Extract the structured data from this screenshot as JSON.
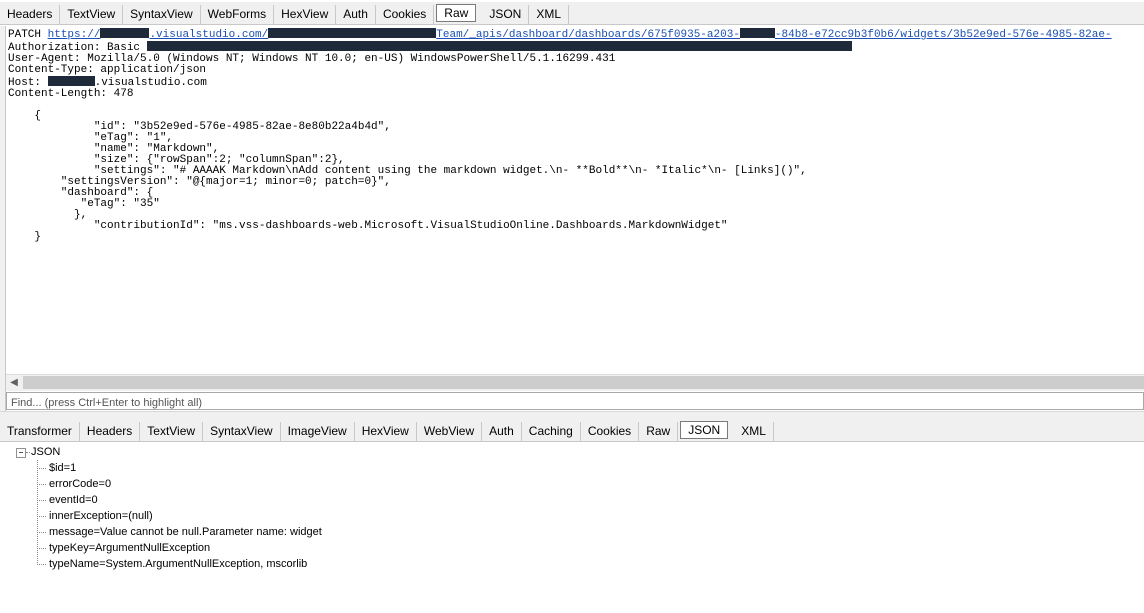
{
  "request_tabs": [
    "Headers",
    "TextView",
    "SyntaxView",
    "WebForms",
    "HexView",
    "Auth",
    "Cookies",
    "Raw",
    "JSON",
    "XML"
  ],
  "request_active_tab": "Raw",
  "raw": {
    "method": "PATCH",
    "url_start": "https://",
    "url_host": ".visualstudio.com/",
    "url_path": "Team/_apis/dashboard/dashboards/675f0935-a203-",
    "url_end": "-84b8-e72cc9b3f0b6/widgets/3b52e9ed-576e-4985-82ae-",
    "auth_line": "Authorization: Basic ",
    "user_agent_line": "User-Agent: Mozilla/5.0 (Windows NT; Windows NT 10.0; en-US) WindowsPowerShell/5.1.16299.431",
    "content_type_line": "Content-Type: application/json",
    "host_label": "Host: ",
    "host_value": ".visualstudio.com",
    "content_length_line": "Content-Length: 478",
    "body": "    {\n             \"id\": \"3b52e9ed-576e-4985-82ae-8e80b22a4b4d\",\n             \"eTag\": \"1\",\n             \"name\": \"Markdown\",\n             \"size\": {\"rowSpan\":2; \"columnSpan\":2},\n             \"settings\": \"# AAAAK Markdown\\nAdd content using the markdown widget.\\n- **Bold**\\n- *Italic*\\n- [Links]()\",\n        \"settingsVersion\": \"@{major=1; minor=0; patch=0}\",\n        \"dashboard\": {\n           \"eTag\": \"35\"\n          },\n             \"contributionId\": \"ms.vss-dashboards-web.Microsoft.VisualStudioOnline.Dashboards.MarkdownWidget\"\n    }"
  },
  "find_placeholder": "Find... (press Ctrl+Enter to highlight all)",
  "response_tabs": [
    "Transformer",
    "Headers",
    "TextView",
    "SyntaxView",
    "ImageView",
    "HexView",
    "WebView",
    "Auth",
    "Caching",
    "Cookies",
    "Raw",
    "JSON",
    "XML"
  ],
  "response_active_tab": "JSON",
  "tree": {
    "expander": "−",
    "root": "JSON",
    "children": [
      "$id=1",
      "errorCode=0",
      "eventId=0",
      "innerException=(null)",
      "message=Value cannot be null.Parameter name: widget",
      "typeKey=ArgumentNullException",
      "typeName=System.ArgumentNullException, mscorlib"
    ]
  }
}
